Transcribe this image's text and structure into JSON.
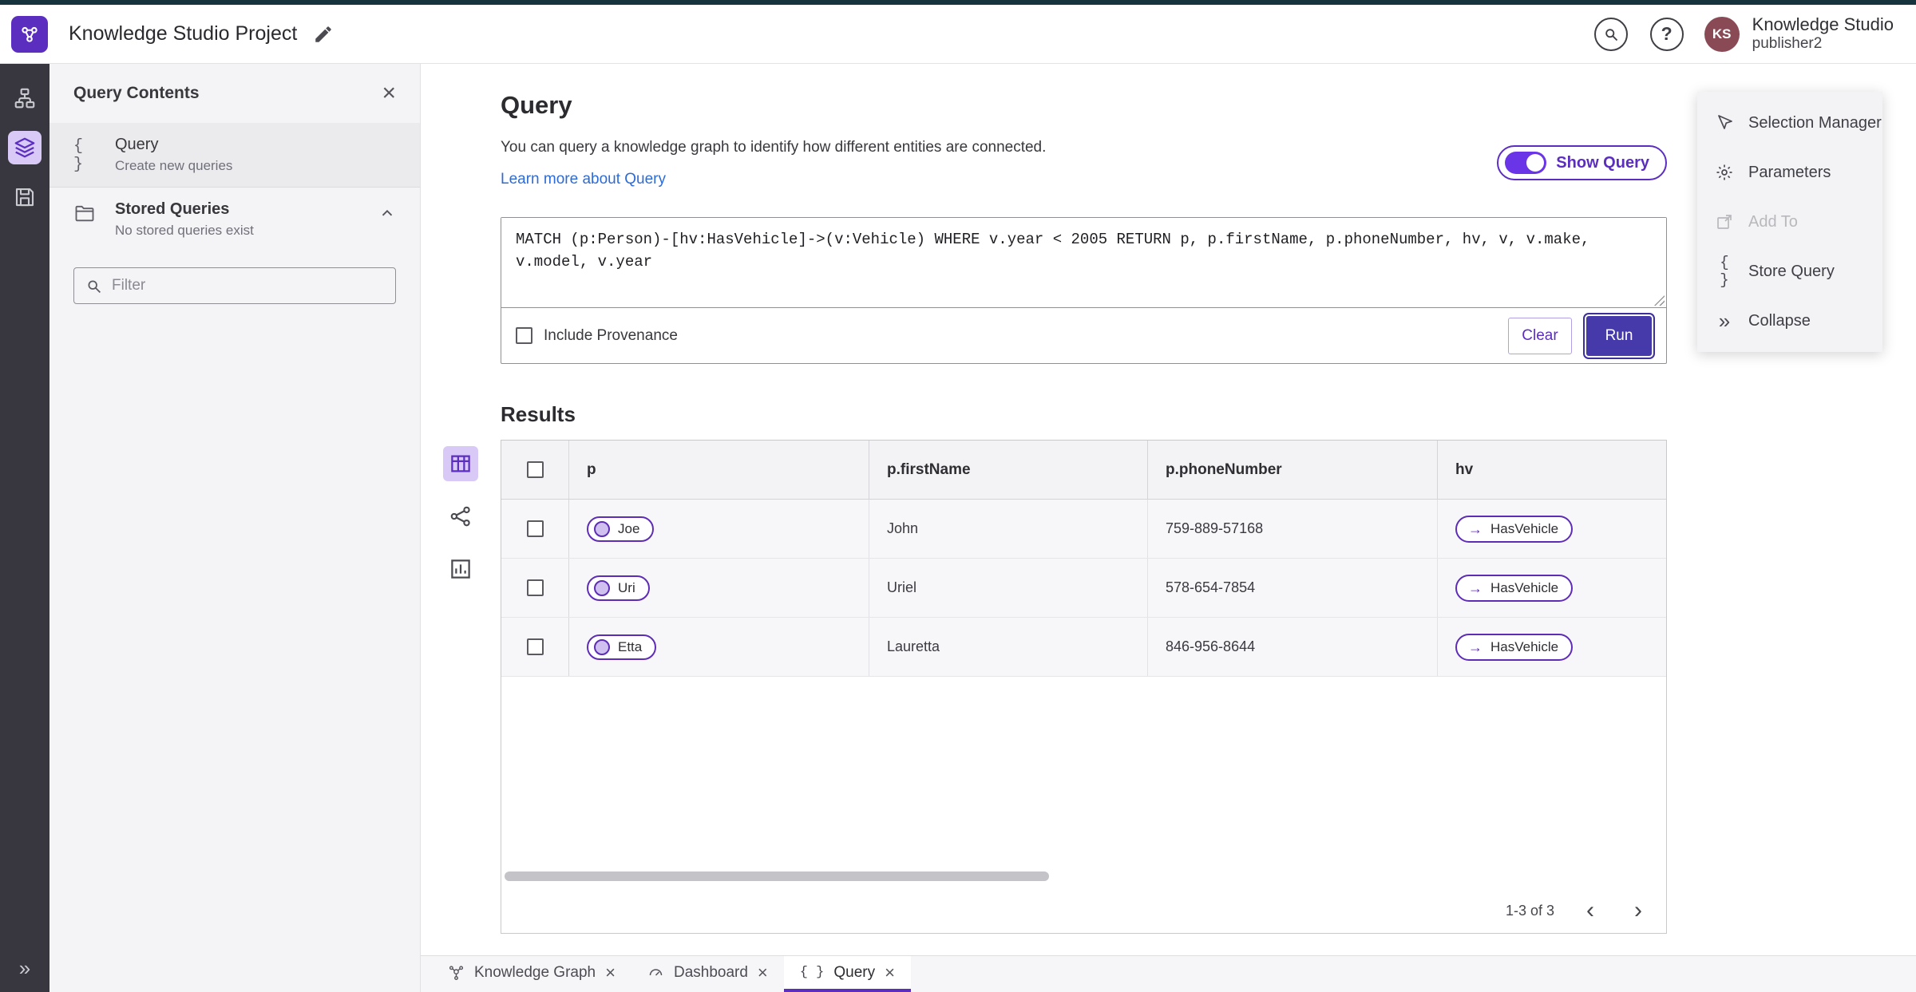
{
  "header": {
    "title": "Knowledge Studio Project",
    "product_name": "Knowledge Studio",
    "username": "publisher2",
    "user_initials": "KS"
  },
  "sidebar": {
    "title": "Query Contents",
    "query_item": {
      "label": "Query",
      "description": "Create new queries"
    },
    "stored_queries": {
      "label": "Stored Queries",
      "description": "No stored queries exist"
    },
    "filter_placeholder": "Filter"
  },
  "query_panel": {
    "title": "Query",
    "description": "You can query a knowledge graph to identify how different entities are connected.",
    "learn_more": "Learn more about Query",
    "show_query_label": "Show Query",
    "query_text": "MATCH (p:Person)-[hv:HasVehicle]->(v:Vehicle) WHERE v.year < 2005 RETURN p, p.firstName, p.phoneNumber, hv, v, v.make, v.model, v.year",
    "include_provenance_label": "Include Provenance",
    "clear_label": "Clear",
    "run_label": "Run"
  },
  "results": {
    "title": "Results",
    "columns": [
      "p",
      "p.firstName",
      "p.phoneNumber",
      "hv"
    ],
    "rows": [
      {
        "p": "Joe",
        "firstName": "John",
        "phoneNumber": "759-889-57168",
        "hv": "HasVehicle"
      },
      {
        "p": "Uri",
        "firstName": "Uriel",
        "phoneNumber": "578-654-7854",
        "hv": "HasVehicle"
      },
      {
        "p": "Etta",
        "firstName": "Lauretta",
        "phoneNumber": "846-956-8644",
        "hv": "HasVehicle"
      }
    ],
    "pagination": "1-3 of 3"
  },
  "context_menu": {
    "selection_manager": "Selection Manager",
    "parameters": "Parameters",
    "add_to": "Add To",
    "store_query": "Store Query",
    "collapse": "Collapse"
  },
  "tabs": [
    {
      "label": "Knowledge Graph"
    },
    {
      "label": "Dashboard"
    },
    {
      "label": "Query"
    }
  ],
  "icons": {
    "close": "×",
    "question": "?",
    "braces": "{ }",
    "arrow_right": "→",
    "chevron_left": "‹",
    "chevron_right": "›",
    "expand": "»",
    "collapse": "»"
  },
  "colors": {
    "accent_purple": "#5b2ec0",
    "run_button": "#463aab",
    "toggle_on": "#6a35e6",
    "node_fill": "#cfc0f0",
    "avatar_bg": "#8a4a55",
    "top_strip": "#16333e"
  }
}
